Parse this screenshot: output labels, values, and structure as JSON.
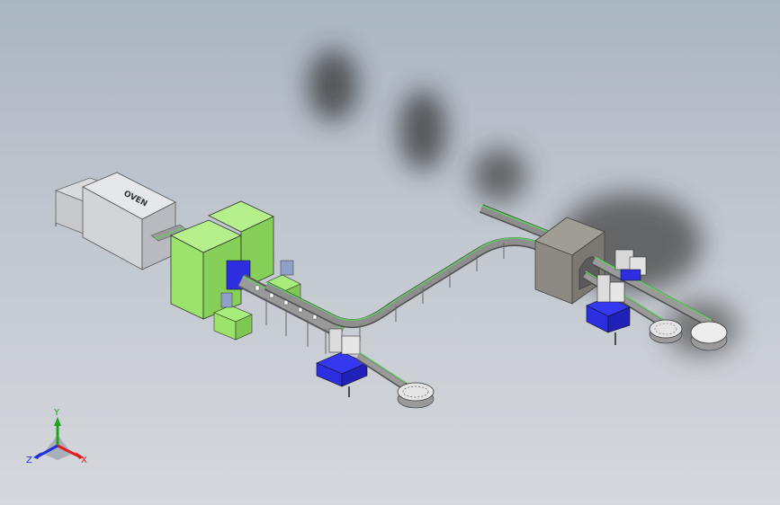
{
  "window": {
    "title": ""
  },
  "scene": {
    "oven_label": "OVEN",
    "background_top": "#aab5c2",
    "background_bottom": "#d5d8dc"
  },
  "triad": {
    "x_label": "X",
    "y_label": "Y",
    "z_label": "Z",
    "x_color": "#e02020",
    "y_color": "#1fa31f",
    "z_color": "#2030e0"
  },
  "colors": {
    "green_cabinet": "#9be36a",
    "blue_machine": "#2c2ee0",
    "conveyor_green": "#5fd05f",
    "tunnel_gray": "#8c8a82",
    "oven_white": "#dcdde0"
  },
  "icons": [
    "triad-icon"
  ]
}
